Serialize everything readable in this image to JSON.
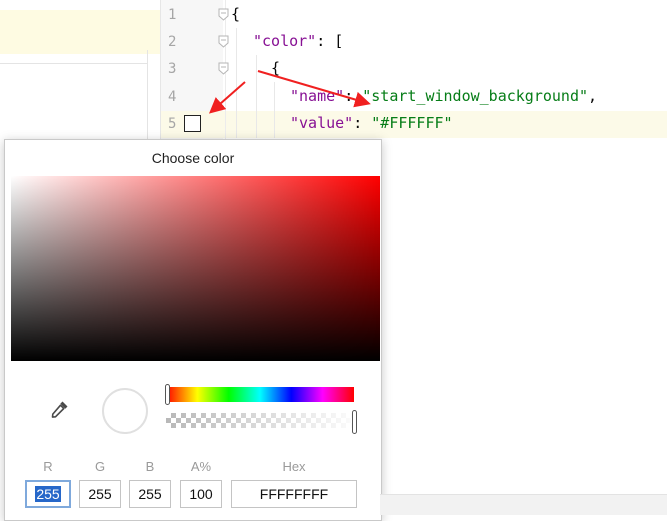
{
  "editor": {
    "line_numbers": [
      "1",
      "2",
      "3",
      "4",
      "5"
    ],
    "lines": [
      {
        "parts": [
          {
            "t": "{",
            "c": "punc"
          }
        ]
      },
      {
        "parts": [
          {
            "t": "\"color\"",
            "c": "key"
          },
          {
            "t": ": [",
            "c": "punc"
          }
        ]
      },
      {
        "parts": [
          {
            "t": "{",
            "c": "punc"
          }
        ]
      },
      {
        "parts": [
          {
            "t": "\"name\"",
            "c": "key"
          },
          {
            "t": ": ",
            "c": "punc"
          },
          {
            "t": "\"start_window_background\"",
            "c": "str"
          },
          {
            "t": ",",
            "c": "punc"
          }
        ]
      },
      {
        "parts": [
          {
            "t": "\"value\"",
            "c": "key"
          },
          {
            "t": ": ",
            "c": "punc"
          },
          {
            "t": "\"#FFFFFF\"",
            "c": "str"
          }
        ]
      }
    ],
    "swatch_color": "#FFFFFF"
  },
  "color_picker": {
    "title": "Choose color",
    "labels": {
      "r": "R",
      "g": "G",
      "b": "B",
      "a": "A%",
      "hex": "Hex"
    },
    "values": {
      "r": "255",
      "g": "255",
      "b": "255",
      "a": "100",
      "hex": "FFFFFFFF"
    },
    "hue_position": 0,
    "alpha_position": 1.0
  },
  "annotations": {
    "arrow_color": "#f02020"
  },
  "icons": [
    "eyedropper-icon",
    "fold-icon"
  ]
}
